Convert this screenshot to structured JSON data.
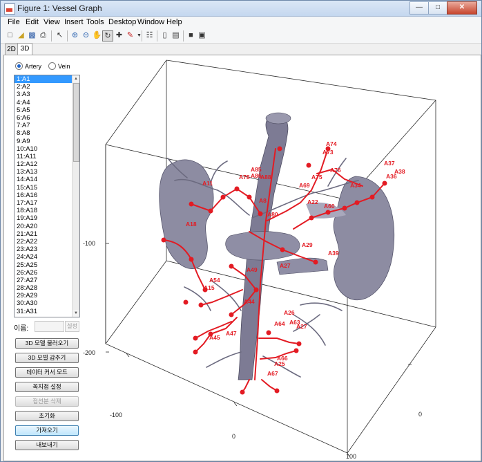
{
  "window": {
    "title": "Figure 1: Vessel Graph"
  },
  "menu": [
    "File",
    "Edit",
    "View",
    "Insert",
    "Tools",
    "Desktop",
    "Window",
    "Help"
  ],
  "tabs": [
    "2D",
    "3D"
  ],
  "radios": {
    "artery": "Artery",
    "vein": "Vein"
  },
  "list_items": [
    "1:A1",
    "2:A2",
    "3:A3",
    "4:A4",
    "5:A5",
    "6:A6",
    "7:A7",
    "8:A8",
    "9:A9",
    "10:A10",
    "11:A11",
    "12:A12",
    "13:A13",
    "14:A14",
    "15:A15",
    "16:A16",
    "17:A17",
    "18:A18",
    "19:A19",
    "20:A20",
    "21:A21",
    "22:A22",
    "23:A23",
    "24:A24",
    "25:A25",
    "26:A26",
    "27:A27",
    "28:A28",
    "29:A29",
    "30:A30",
    "31:A31"
  ],
  "name_field": {
    "label": "이름:",
    "button": "설정"
  },
  "buttons": [
    "3D 모델 불러오기",
    "3D 모델 감추기",
    "데이터 커서 모드",
    "꼭지점 설정",
    "접선분 삭제",
    "초기화",
    "가져오기",
    "내보내기"
  ],
  "axes": {
    "ticks": [
      "-100",
      "-200",
      "-100",
      "0",
      "100",
      "0"
    ]
  },
  "vessel_labels": [
    "A74",
    "A73",
    "A76",
    "A37",
    "A38",
    "A36",
    "A34",
    "A11",
    "A78",
    "A85",
    "A86",
    "A88",
    "A69",
    "A75",
    "A60",
    "A18",
    "A29",
    "A39",
    "A27",
    "A49",
    "A54",
    "A15",
    "A44",
    "A26",
    "A64",
    "A63",
    "A27",
    "A45",
    "A47",
    "A66",
    "A25",
    "A67",
    "A8",
    "A80",
    "A22"
  ]
}
